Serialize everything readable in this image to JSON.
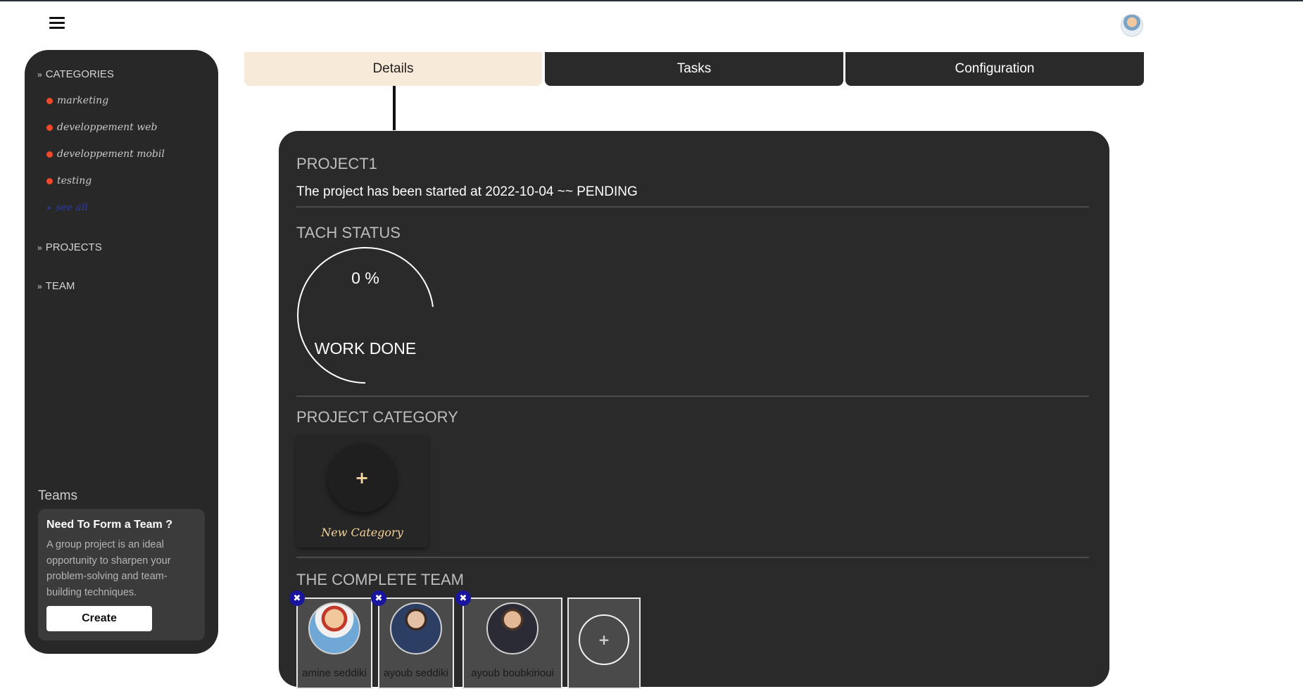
{
  "header": {
    "menu_icon": "hamburger-icon",
    "user_avatar": "user-avatar"
  },
  "sidebar": {
    "categories_header": "CATEGORIES",
    "categories": [
      {
        "label": "marketing"
      },
      {
        "label": "developpement web"
      },
      {
        "label": "developpement mobil"
      },
      {
        "label": "testing"
      }
    ],
    "see_all": "see all",
    "projects_header": "PROJECTS",
    "team_header": "TEAM",
    "teams_title": "Teams",
    "teams_card": {
      "heading": "Need To Form a Team ?",
      "text": "A group project is an ideal opportunity to sharpen your problem-solving and team-building techniques.",
      "button": "Create"
    }
  },
  "tabs": [
    {
      "label": "Details",
      "active": true
    },
    {
      "label": "Tasks",
      "active": false
    },
    {
      "label": "Configuration",
      "active": false
    }
  ],
  "project": {
    "name": "PROJECT1",
    "status_line": "The project has been started at 2022-10-04 ~~ PENDING",
    "status_section": "TACH STATUS",
    "progress_percent": 0,
    "progress_text": "0 %",
    "progress_label": "WORK DONE",
    "category_section": "PROJECT CATEGORY",
    "new_category": "New Category",
    "team_section": "THE COMPLETE TEAM",
    "members": [
      {
        "name": "amine seddiki"
      },
      {
        "name": "ayoub seddiki"
      },
      {
        "name": "ayoub boubkirioui"
      }
    ],
    "add_member_symbol": "+"
  },
  "colors": {
    "accent_dot": "#f0482a",
    "active_tab": "#f8ead8",
    "panel": "#2a2a2a",
    "remove_badge": "#1a159e"
  }
}
